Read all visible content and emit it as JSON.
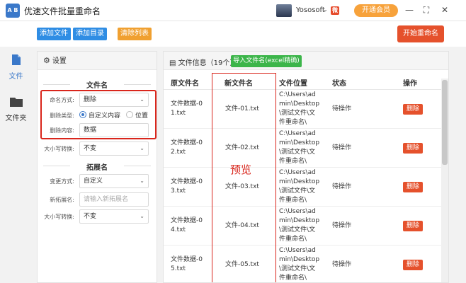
{
  "app": {
    "logo_text": "A B",
    "title": "优速文件批量重命名",
    "user_name": "Yososoft",
    "user_caret": "⌄",
    "vip_label": "开通会员",
    "minimize": "—",
    "maximize": "⛶",
    "close": "✕"
  },
  "toolbar": {
    "add_file": "添加文件",
    "add_dir": "添加目录",
    "clear_list": "清除列表",
    "start": "开始重命名"
  },
  "nav": {
    "file_label": "文件",
    "folder_label": "文件夹"
  },
  "settings": {
    "title": "设置",
    "section_filename": "文件名",
    "naming_label": "命名方式:",
    "naming_value": "删除",
    "delete_type_label": "删除类型:",
    "radio_custom": "自定义内容",
    "radio_position": "位置",
    "delete_content_label": "删除内容:",
    "delete_content_value": "数据",
    "case_label": "大小写转换:",
    "case_value": "不变",
    "section_ext": "拓展名",
    "ext_mode_label": "变更方式:",
    "ext_mode_value": "自定义",
    "new_ext_label": "新拓展名:",
    "new_ext_placeholder": "请输入新拓展名",
    "ext_case_label": "大小写转换:",
    "ext_case_value": "不变"
  },
  "file_panel": {
    "title": "文件信息（19个）",
    "import_btn": "导入文件名(excel精确)",
    "columns": {
      "original": "原文件名",
      "new": "新文件名",
      "location": "文件位置",
      "status": "状态",
      "action": "操作"
    },
    "preview_label": "预览",
    "rows": [
      {
        "orig1": "文件数据-0",
        "orig2": "1.txt",
        "new": "文件-01.txt",
        "loc1": "C:\\Users\\ad",
        "loc2": "min\\Desktop",
        "loc3": "\\测试文件\\文",
        "loc4": "件重命名\\",
        "status": "待操作",
        "action": "删除"
      },
      {
        "orig1": "文件数据-0",
        "orig2": "2.txt",
        "new": "文件-02.txt",
        "loc1": "C:\\Users\\ad",
        "loc2": "min\\Desktop",
        "loc3": "\\测试文件\\文",
        "loc4": "件重命名\\",
        "status": "待操作",
        "action": "删除"
      },
      {
        "orig1": "文件数据-0",
        "orig2": "3.txt",
        "new": "文件-03.txt",
        "loc1": "C:\\Users\\ad",
        "loc2": "min\\Desktop",
        "loc3": "\\测试文件\\文",
        "loc4": "件重命名\\",
        "status": "待操作",
        "action": "删除"
      },
      {
        "orig1": "文件数据-0",
        "orig2": "4.txt",
        "new": "文件-04.txt",
        "loc1": "C:\\Users\\ad",
        "loc2": "min\\Desktop",
        "loc3": "\\测试文件\\文",
        "loc4": "件重命名\\",
        "status": "待操作",
        "action": "删除"
      },
      {
        "orig1": "文件数据-0",
        "orig2": "5.txt",
        "new": "文件-05.txt",
        "loc1": "C:\\Users\\ad",
        "loc2": "min\\Desktop",
        "loc3": "\\测试文件\\文",
        "loc4": "件重命名\\",
        "status": "待操作",
        "action": "删除"
      }
    ]
  },
  "colors": {
    "primary_blue": "#3a78c9",
    "add_button_blue": "#2f8de4",
    "clear_orange": "#f0a030",
    "start_red": "#e5512c",
    "import_green": "#3cb54a",
    "highlight_red": "#d9261c",
    "vip_orange": "#f7a23b"
  },
  "icons": {
    "file_nav": "file-icon",
    "folder_nav": "folder-icon",
    "settings": "gear-icon",
    "file_info": "document-icon",
    "weibo": "weibo-icon"
  }
}
